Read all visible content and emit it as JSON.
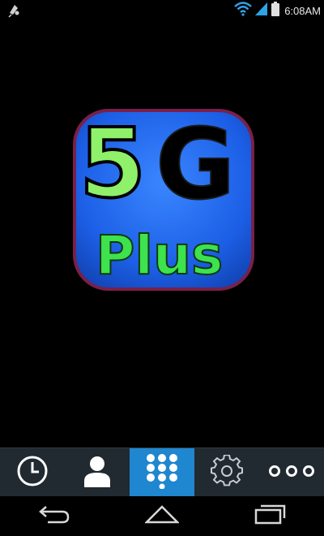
{
  "status_bar": {
    "time": "6:08AM",
    "icons": [
      "app-notification-icon",
      "wifi-icon",
      "signal-icon",
      "battery-icon"
    ]
  },
  "splash": {
    "logo_top_text": "5G",
    "logo_bottom_text": "Plus",
    "colors": {
      "logo_bg": "#1c5fe6",
      "logo_border": "#7a1f4a",
      "five": "#8ff06a",
      "g": "#000000",
      "plus": "#3ee24c"
    }
  },
  "tab_bar": {
    "tabs": [
      {
        "icon": "clock-icon",
        "active": false
      },
      {
        "icon": "person-icon",
        "active": false
      },
      {
        "icon": "dialpad-icon",
        "active": true
      },
      {
        "icon": "gear-icon",
        "active": false
      },
      {
        "icon": "more-dots-icon",
        "active": false
      }
    ],
    "colors": {
      "bar": "#212a30",
      "active": "#1f86d0",
      "icon": "#ffffff"
    }
  },
  "nav_bar": {
    "buttons": [
      "back-icon",
      "home-icon",
      "recent-apps-icon"
    ]
  }
}
